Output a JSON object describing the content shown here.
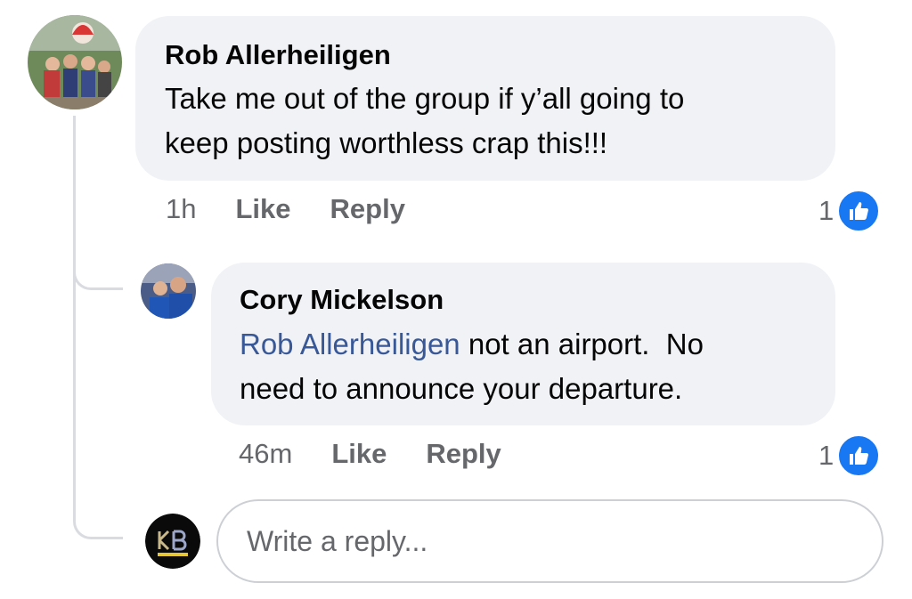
{
  "comments": [
    {
      "author": "Rob Allerheiligen",
      "text_line1": "Take me out of the group if y’all going to",
      "text_line2": "keep posting worthless crap this!!!",
      "time": "1h",
      "like_label": "Like",
      "reply_label": "Reply",
      "like_count": "1"
    }
  ],
  "replies": [
    {
      "author": "Cory Mickelson",
      "mention": "Rob Allerheiligen",
      "text_line1_rest": " not an airport.  No",
      "text_line2": "need to announce your departure.",
      "time": "46m",
      "like_label": "Like",
      "reply_label": "Reply",
      "like_count": "1"
    }
  ],
  "reply_box": {
    "placeholder": "Write a reply..."
  },
  "colors": {
    "bubble": "#f0f2f5",
    "mention": "#385898",
    "like_badge": "#1877f2",
    "meta_text": "#65676b"
  },
  "icons": {
    "like": "thumbs-up-icon"
  }
}
